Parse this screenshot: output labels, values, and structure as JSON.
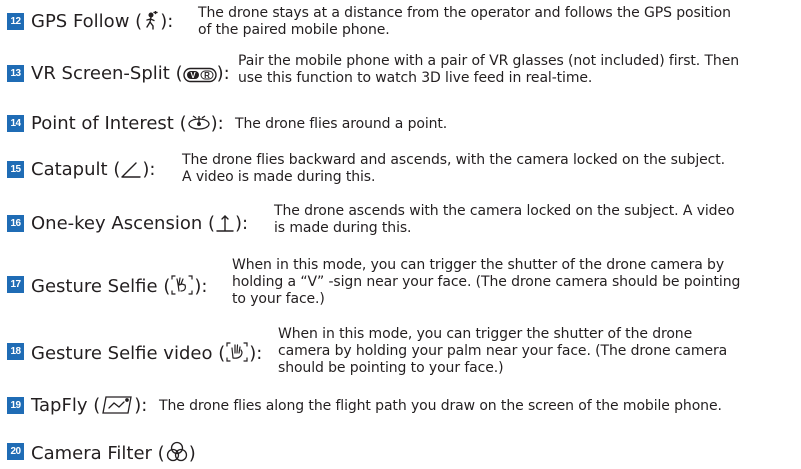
{
  "items": [
    {
      "number": "12",
      "title": "GPS Follow",
      "icon": "person-walking-gps-icon",
      "desc": [
        "The drone stays at a distance from the operator and follows the GPS position",
        "of the paired mobile phone."
      ]
    },
    {
      "number": "13",
      "title": "VR Screen-Split",
      "icon": "vr-glasses-icon",
      "desc": [
        "Pair the mobile phone with a pair of VR glasses (not included) first. Then",
        "use this function to watch 3D live feed in real-time."
      ]
    },
    {
      "number": "14",
      "title": "Point of Interest",
      "icon": "orbit-point-icon",
      "desc": [
        "The drone flies around a point."
      ]
    },
    {
      "number": "15",
      "title": "Catapult",
      "icon": "catapult-angle-icon",
      "desc": [
        "The drone flies backward and ascends, with the camera locked on the subject.",
        "A video is made during this."
      ]
    },
    {
      "number": "16",
      "title": "One-key Ascension",
      "icon": "ascend-arrow-icon",
      "desc": [
        "The drone ascends with the camera locked on the subject. A video",
        "is made during this."
      ]
    },
    {
      "number": "17",
      "title": "Gesture Selfie",
      "icon": "v-sign-hand-icon",
      "desc": [
        "When in this mode, you can trigger the shutter of the drone camera by",
        "holding a “V” -sign near your face. (The drone camera should be pointing",
        "to your face.)"
      ]
    },
    {
      "number": "18",
      "title": "Gesture Selfie video",
      "icon": "open-palm-hand-icon",
      "desc": [
        "When in this mode, you can trigger the shutter of the drone",
        "camera by holding your palm near your face. (The drone camera",
        "should be pointing to your face.)"
      ]
    },
    {
      "number": "19",
      "title": "TapFly",
      "icon": "tap-fly-screen-icon",
      "desc": [
        "The drone flies along the flight path you draw on the screen of the mobile phone."
      ]
    },
    {
      "number": "20",
      "title": "Camera Filter",
      "icon": "camera-filter-circles-icon",
      "desc": []
    }
  ]
}
